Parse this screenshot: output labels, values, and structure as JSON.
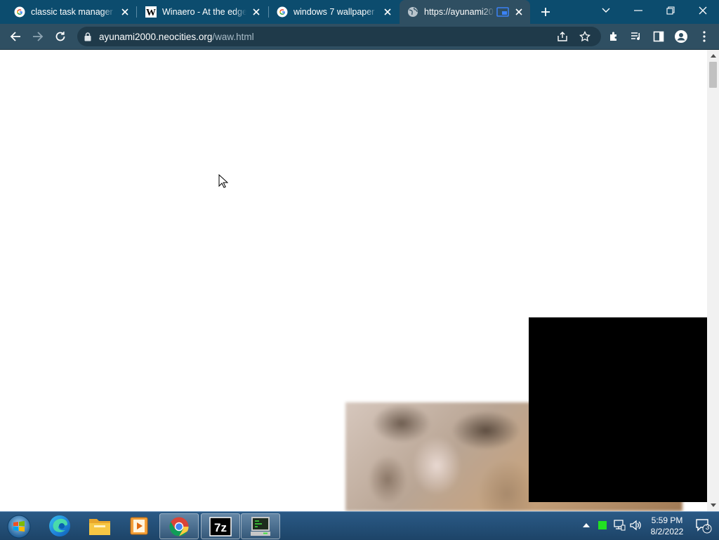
{
  "browser": {
    "tabs": [
      {
        "title": "classic task manager d",
        "favicon": "google-icon",
        "active": false
      },
      {
        "title": "Winaero - At the edge",
        "favicon": "winaero-icon",
        "active": false
      },
      {
        "title": "windows 7 wallpaper -",
        "favicon": "google-icon",
        "active": false
      },
      {
        "title": "https://ayunami20",
        "favicon": "globe-icon",
        "active": true,
        "badge": "picture-in-picture-icon"
      }
    ],
    "url_host": "ayunami2000.neocities.org",
    "url_path": "/waw.html"
  },
  "taskbar": {
    "apps": [
      "edge-icon",
      "file-explorer-icon",
      "media-player-icon",
      "chrome-icon",
      "7zip-icon",
      "terminal-icon"
    ],
    "sevenzip_label": "7z",
    "clock_time": "5:59 PM",
    "clock_date": "8/2/2022",
    "notification_count": "3"
  },
  "colors": {
    "tabstrip": "#0c4c6e",
    "toolbar": "#2f4f62",
    "taskbar": "#1d4468"
  }
}
